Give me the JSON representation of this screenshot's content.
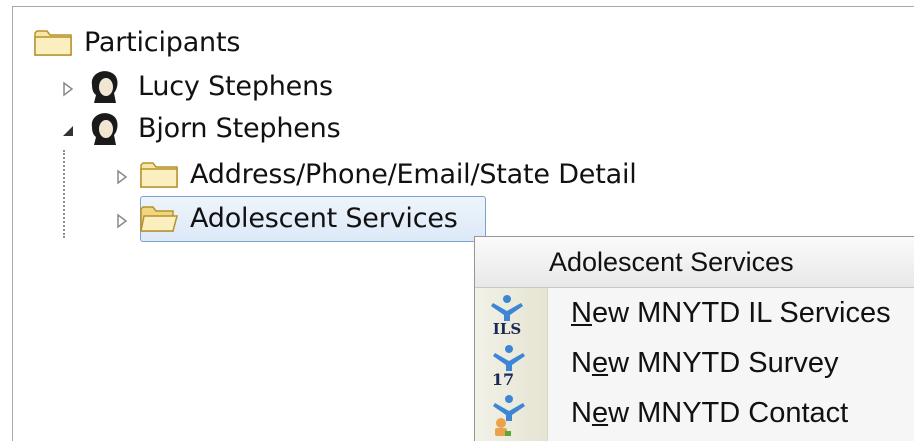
{
  "tree": {
    "root": {
      "label": "Participants",
      "icon": "folder-icon"
    },
    "participants": [
      {
        "label": "Lucy Stephens",
        "expanded": false,
        "icon": "person-icon"
      },
      {
        "label": "Bjorn Stephens",
        "expanded": true,
        "icon": "person-icon",
        "children": [
          {
            "label": "Address/Phone/Email/State Detail",
            "icon": "folder-icon",
            "selected": false
          },
          {
            "label": "Adolescent Services",
            "icon": "folder-icon",
            "selected": true
          }
        ]
      }
    ]
  },
  "context_menu": {
    "header": "Adolescent Services",
    "items": [
      {
        "label": "New MNYTD IL Services",
        "mnemonic": "N",
        "icon": "ils-icon",
        "icon_text": "ILS"
      },
      {
        "label": "New MNYTD Survey",
        "mnemonic": "e",
        "icon": "survey-17-icon",
        "icon_text": "17"
      },
      {
        "label": "New MNYTD Contact",
        "mnemonic": "e",
        "icon": "contact-icon"
      }
    ]
  },
  "colors": {
    "folder_fill": "#f7e7a6",
    "folder_stroke": "#c9a640",
    "selection_border": "#7da2ce",
    "menu_gutter": "#e8e6d4",
    "icon_blue": "#3d86d6"
  }
}
